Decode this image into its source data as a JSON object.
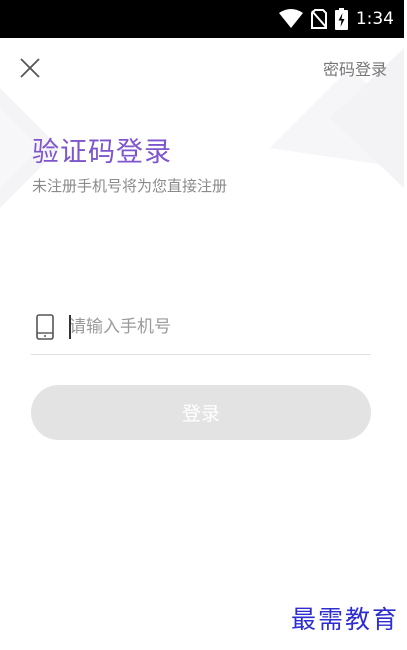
{
  "status_bar": {
    "time": "1:34",
    "icons": [
      "wifi-icon",
      "no-sim-icon",
      "battery-charging-icon"
    ]
  },
  "header": {
    "close_icon": "close-icon",
    "password_login_label": "密码登录"
  },
  "main": {
    "title": "验证码登录",
    "subtitle": "未注册手机号将为您直接注册",
    "phone_input": {
      "icon": "phone-icon",
      "placeholder": "请输入手机号",
      "value": ""
    },
    "login_button_label": "登录"
  },
  "watermark": "最需教育",
  "colors": {
    "title": "#7d55cc",
    "button_disabled": "#e3e3e3",
    "watermark": "#2d2dd0"
  }
}
